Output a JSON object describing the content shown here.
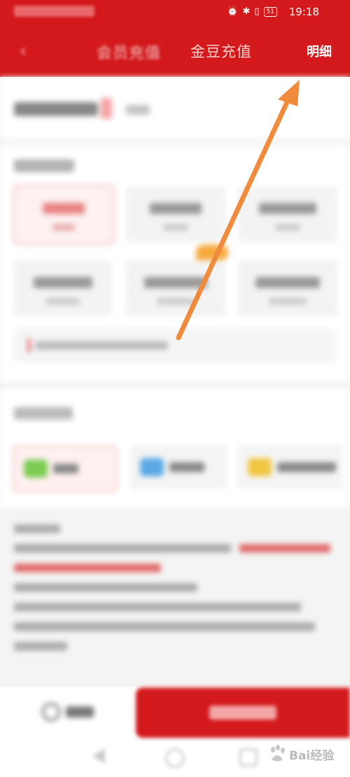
{
  "status_bar": {
    "time": "19:18",
    "battery": "51"
  },
  "header": {
    "tab_coupon": "会员充值",
    "tab_gold": "金豆充值",
    "detail_label": "明细"
  },
  "watermark": {
    "text": "Bai经验"
  },
  "colors": {
    "brand_red": "#d3191c",
    "arrow_orange": "#f08a3c"
  }
}
